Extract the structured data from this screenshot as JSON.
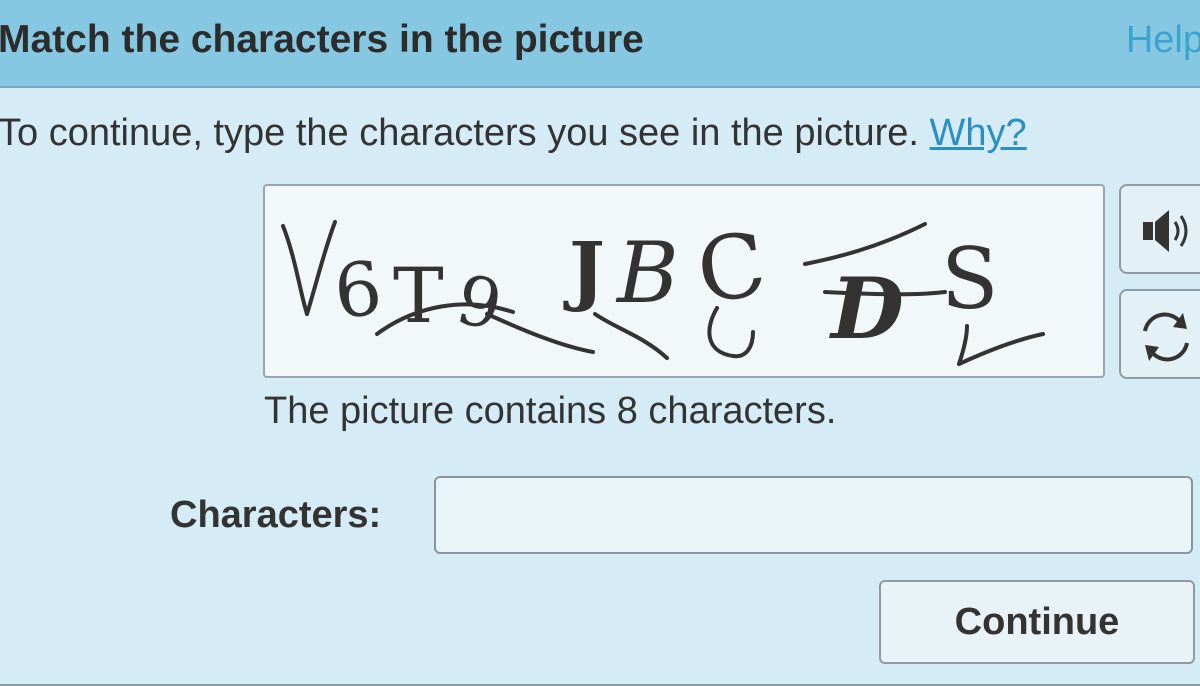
{
  "dialog": {
    "title": "Match the characters in the picture",
    "help_label": "Help"
  },
  "instruction": {
    "text": "To continue, type the characters you see in the picture.",
    "why_label": "Why?"
  },
  "captcha": {
    "glyphs": [
      "V",
      "6",
      "T",
      "9",
      "J",
      "B",
      "C",
      "D",
      "S"
    ],
    "audio_icon": "speaker-icon",
    "refresh_icon": "refresh-icon"
  },
  "char_count_text": "The picture contains 8 characters.",
  "form": {
    "label": "Characters:",
    "value": "",
    "submit_label": "Continue"
  },
  "colors": {
    "titlebar": "#86c8e2",
    "background": "#d5ebf5",
    "link": "#2a8fc1",
    "text": "#333333"
  }
}
